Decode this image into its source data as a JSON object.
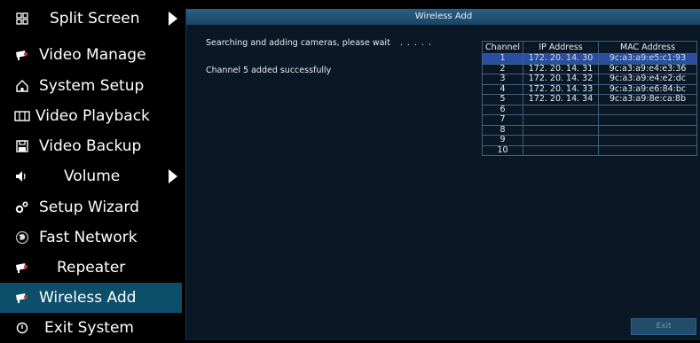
{
  "sidebar": {
    "items": [
      {
        "label": "Split Screen",
        "icon": "grid-icon",
        "has_arrow": true
      },
      {
        "label": "Video Manage",
        "icon": "camera-icon"
      },
      {
        "label": "System Setup",
        "icon": "home-icon"
      },
      {
        "label": "Video Playback",
        "icon": "film-icon"
      },
      {
        "label": "Video Backup",
        "icon": "floppy-icon"
      },
      {
        "label": "Volume",
        "icon": "speaker-icon",
        "has_arrow": true
      },
      {
        "label": "Setup Wizard",
        "icon": "gears-icon"
      },
      {
        "label": "Fast Network",
        "icon": "globe-icon"
      },
      {
        "label": "Repeater",
        "icon": "camera-icon"
      },
      {
        "label": "Wireless Add",
        "icon": "camera-icon",
        "active": true
      },
      {
        "label": "Exit System",
        "icon": "power-icon"
      }
    ]
  },
  "panel": {
    "title": "Wireless Add",
    "searching_text": "Searching and adding cameras, please wait",
    "searching_dots": ". . . . .",
    "result_text": "Channel 5 added successfully",
    "exit_label": "Exit"
  },
  "table": {
    "headers": [
      "Channel",
      "IP Address",
      "MAC Address"
    ],
    "rows": [
      {
        "channel": "1",
        "ip": "172. 20. 14. 30",
        "mac": "9c:a3:a9:e5:c1:93",
        "selected": true
      },
      {
        "channel": "2",
        "ip": "172. 20. 14. 31",
        "mac": "9c:a3:a9:e4:e3:36"
      },
      {
        "channel": "3",
        "ip": "172. 20. 14. 32",
        "mac": "9c:a3:a9:e4:e2:dc"
      },
      {
        "channel": "4",
        "ip": "172. 20. 14. 33",
        "mac": "9c:a3:a9:e6:84:bc"
      },
      {
        "channel": "5",
        "ip": "172. 20. 14. 34",
        "mac": "9c:a3:a9:8e:ca:8b"
      },
      {
        "channel": "6",
        "ip": "",
        "mac": ""
      },
      {
        "channel": "7",
        "ip": "",
        "mac": ""
      },
      {
        "channel": "8",
        "ip": "",
        "mac": ""
      },
      {
        "channel": "9",
        "ip": "",
        "mac": ""
      },
      {
        "channel": "10",
        "ip": "",
        "mac": ""
      }
    ]
  },
  "colors": {
    "active_item": "#0d4f6b",
    "selected_row": "#2a4fa0",
    "panel_bg": "#0a1724"
  }
}
